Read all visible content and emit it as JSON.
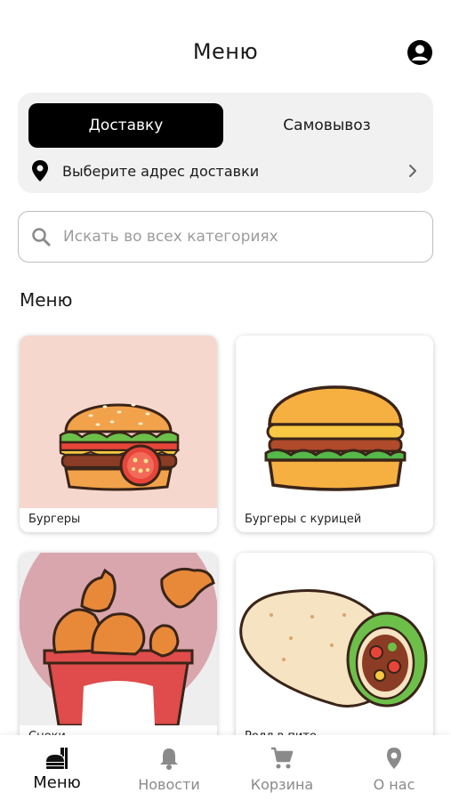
{
  "header": {
    "title": "Меню"
  },
  "delivery_mode": {
    "tabs": [
      {
        "label": "Доставку",
        "selected": true
      },
      {
        "label": "Самовывоз",
        "selected": false
      }
    ],
    "address_label": "Выберите адрес доставки"
  },
  "search": {
    "placeholder": "Искать во всех категориях"
  },
  "menu": {
    "section_title": "Меню",
    "categories": [
      {
        "label": "Бургеры"
      },
      {
        "label": "Бургеры с курицей"
      },
      {
        "label": "Снеки"
      },
      {
        "label": "Ролл в пите"
      }
    ]
  },
  "bottom_nav": {
    "items": [
      {
        "label": "Меню",
        "icon": "food-icon",
        "active": true
      },
      {
        "label": "Новости",
        "icon": "bell-icon",
        "active": false
      },
      {
        "label": "Корзина",
        "icon": "cart-icon",
        "active": false
      },
      {
        "label": "О нас",
        "icon": "location-pin-icon",
        "active": false
      }
    ]
  },
  "colors": {
    "accent": "#000000",
    "card_background": "#f1f1f1",
    "burger_tile_background": "#f6d7ce",
    "snacks_tile_background": "#d9a6ad"
  }
}
